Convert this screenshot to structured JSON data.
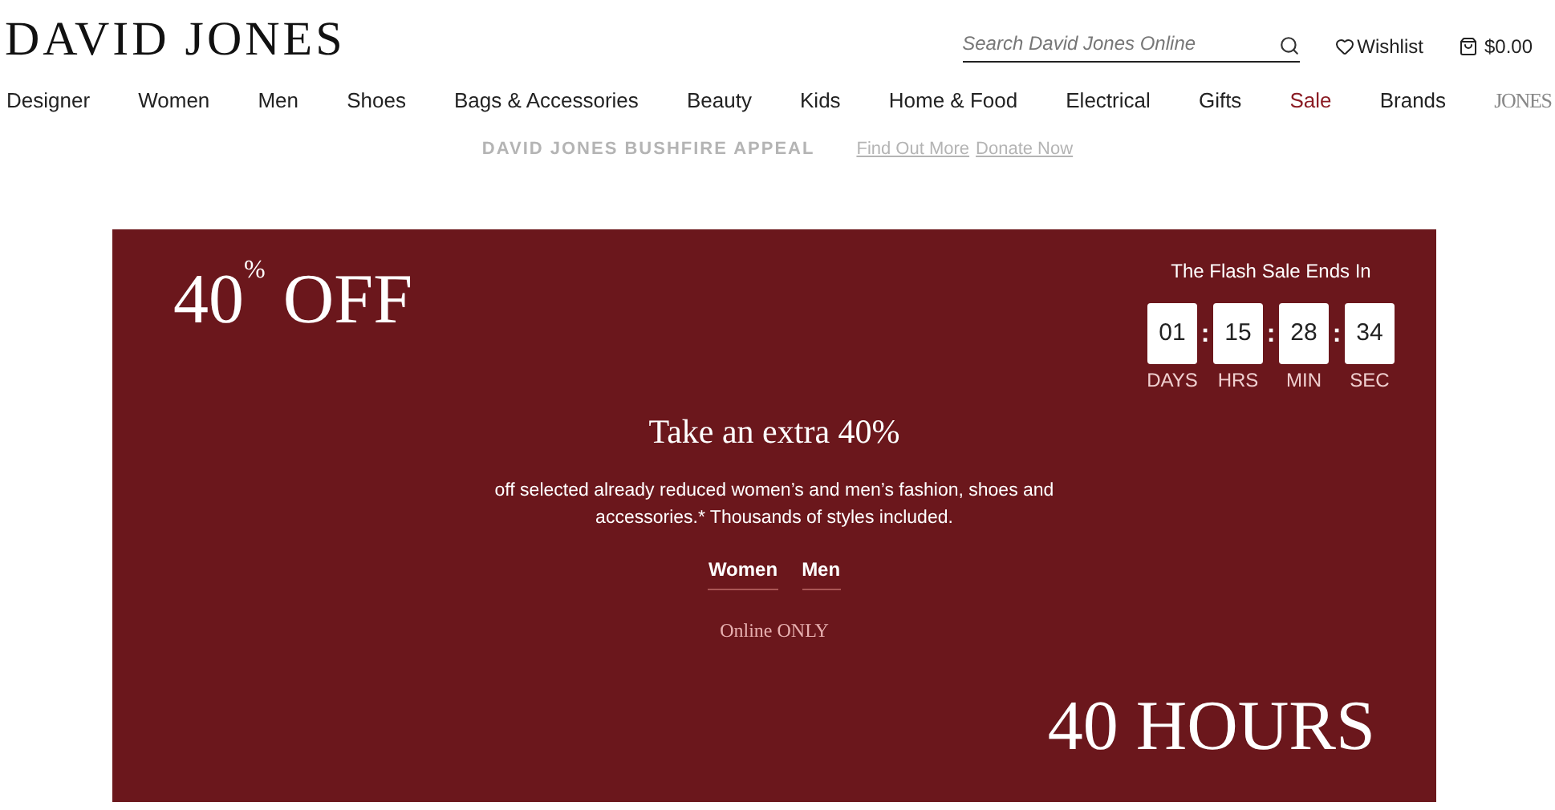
{
  "header": {
    "logo": "DAVID JONES",
    "search": {
      "placeholder": "Search David Jones Online"
    },
    "wishlist": "Wishlist",
    "cart": "$0.00"
  },
  "nav": [
    {
      "label": "Designer",
      "kind": "link"
    },
    {
      "label": "Women",
      "kind": "link"
    },
    {
      "label": "Men",
      "kind": "link"
    },
    {
      "label": "Shoes",
      "kind": "link"
    },
    {
      "label": "Bags & Accessories",
      "kind": "link"
    },
    {
      "label": "Beauty",
      "kind": "link"
    },
    {
      "label": "Kids",
      "kind": "link"
    },
    {
      "label": "Home & Food",
      "kind": "link"
    },
    {
      "label": "Electrical",
      "kind": "link"
    },
    {
      "label": "Gifts",
      "kind": "link"
    },
    {
      "label": "Sale",
      "kind": "sale"
    },
    {
      "label": "Brands",
      "kind": "link"
    },
    {
      "label": "JONES",
      "kind": "logo"
    }
  ],
  "appeal": {
    "title": "DAVID JONES BUSHFIRE APPEAL",
    "links": [
      "Find Out More",
      "Donate Now"
    ]
  },
  "banner": {
    "headline": "40",
    "headline_sup": "%",
    "headline_rest": "OFF",
    "countdown_title": "The Flash Sale Ends In",
    "countdown": [
      {
        "value": "01",
        "unit": "DAYS"
      },
      {
        "value": "15",
        "unit": "HRS"
      },
      {
        "value": "28",
        "unit": "MIN"
      },
      {
        "value": "34",
        "unit": "SEC"
      }
    ],
    "separator": ":",
    "subtitle": "Take an extra 40%",
    "body": "off selected already reduced women’s and men’s fashion, shoes and accessories.* Thousands of styles included.",
    "links": [
      "Women",
      "Men"
    ],
    "note": "Online ONLY",
    "footer": "40 HOURS"
  }
}
